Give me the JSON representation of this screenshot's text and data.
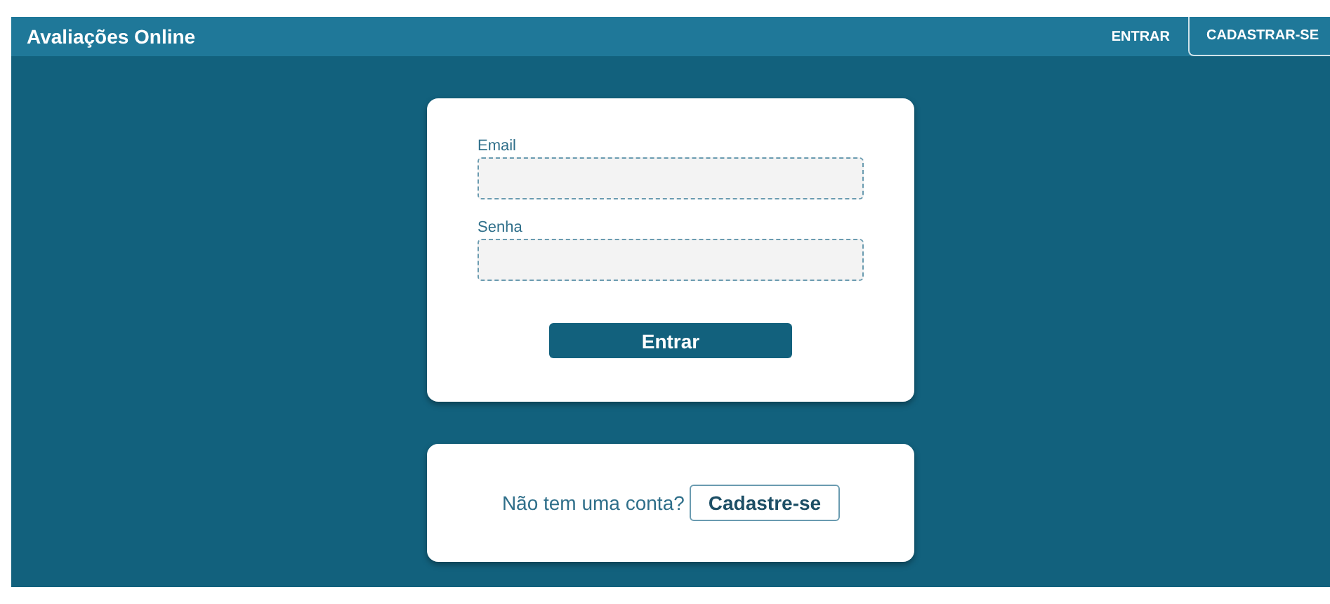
{
  "header": {
    "title": "Avaliações Online",
    "links": [
      {
        "label": "ENTRAR",
        "outlined": false
      },
      {
        "label": "CADASTRAR-SE",
        "outlined": true
      }
    ]
  },
  "login": {
    "fields": [
      {
        "label": "Email"
      },
      {
        "label": "Senha"
      }
    ],
    "submit": "Entrar"
  },
  "signup": {
    "text": "Não tem uma conta?",
    "button": "Cadastre-se"
  }
}
